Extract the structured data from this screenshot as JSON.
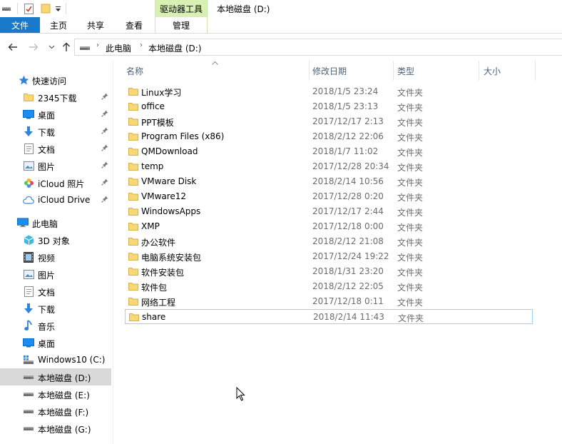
{
  "colors": {
    "accent_blue": "#1979ca",
    "context_tab_green": "#d8f0b3",
    "folder_yellow": "#f8d775",
    "selection_border": "#99d1ff",
    "nav_selected": "#d9d9d9",
    "header_text": "#4c607a",
    "secondary_text": "#6d6d6d"
  },
  "titlebar": {
    "context_tab_label": "驱动器工具",
    "window_title": "本地磁盘 (D:)",
    "quick_access_icons": [
      "drive-icon",
      "properties-icon",
      "new-folder-icon",
      "customize-toolbar-icon"
    ]
  },
  "ribbon": {
    "tabs": {
      "file": "文件",
      "home": "主页",
      "share": "共享",
      "view": "查看",
      "manage": "管理"
    }
  },
  "address": {
    "segments": [
      "此电脑",
      "本地磁盘 (D:)"
    ]
  },
  "nav": {
    "quick_access": "快速访问",
    "quick_items": [
      {
        "label": "2345下载",
        "icon": "folder-icon",
        "pinned": true
      },
      {
        "label": "桌面",
        "icon": "desktop-icon",
        "pinned": true
      },
      {
        "label": "下载",
        "icon": "download-icon",
        "pinned": true
      },
      {
        "label": "文档",
        "icon": "documents-icon",
        "pinned": true
      },
      {
        "label": "图片",
        "icon": "pictures-icon",
        "pinned": true
      },
      {
        "label": "iCloud 照片",
        "icon": "icloud-photos-icon",
        "pinned": true
      },
      {
        "label": "iCloud Drive",
        "icon": "icloud-drive-icon",
        "pinned": true
      }
    ],
    "this_pc": "此电脑",
    "pc_items": [
      {
        "label": "3D 对象",
        "icon": "3d-objects-icon"
      },
      {
        "label": "视频",
        "icon": "videos-icon"
      },
      {
        "label": "图片",
        "icon": "pictures-icon"
      },
      {
        "label": "文档",
        "icon": "documents-icon"
      },
      {
        "label": "下载",
        "icon": "download-icon"
      },
      {
        "label": "音乐",
        "icon": "music-icon"
      },
      {
        "label": "桌面",
        "icon": "desktop-icon"
      },
      {
        "label": "Windows10 (C:)",
        "icon": "windows-drive-icon"
      },
      {
        "label": "本地磁盘 (D:)",
        "icon": "drive-icon",
        "selected": true
      },
      {
        "label": "本地磁盘 (E:)",
        "icon": "drive-icon"
      },
      {
        "label": "本地磁盘 (F:)",
        "icon": "drive-icon"
      },
      {
        "label": "本地磁盘 (G:)",
        "icon": "drive-icon"
      }
    ]
  },
  "list": {
    "headers": {
      "name": "名称",
      "modified": "修改日期",
      "type": "类型",
      "size": "大小"
    },
    "rows": [
      {
        "name": "Linux学习",
        "modified": "2018/1/5 23:24",
        "type": "文件夹"
      },
      {
        "name": "office",
        "modified": "2018/1/5 23:13",
        "type": "文件夹"
      },
      {
        "name": "PPT模板",
        "modified": "2017/12/17 2:13",
        "type": "文件夹"
      },
      {
        "name": "Program Files (x86)",
        "modified": "2018/2/12 22:06",
        "type": "文件夹"
      },
      {
        "name": "QMDownload",
        "modified": "2018/1/7 11:02",
        "type": "文件夹"
      },
      {
        "name": "temp",
        "modified": "2017/12/28 20:34",
        "type": "文件夹"
      },
      {
        "name": "VMware Disk",
        "modified": "2018/2/14 10:56",
        "type": "文件夹"
      },
      {
        "name": "VMware12",
        "modified": "2017/12/28 0:20",
        "type": "文件夹"
      },
      {
        "name": "WindowsApps",
        "modified": "2017/12/17 2:44",
        "type": "文件夹"
      },
      {
        "name": "XMP",
        "modified": "2017/12/18 0:00",
        "type": "文件夹"
      },
      {
        "name": "办公软件",
        "modified": "2018/2/12 21:08",
        "type": "文件夹"
      },
      {
        "name": "电脑系统安装包",
        "modified": "2017/12/24 19:22",
        "type": "文件夹"
      },
      {
        "name": "软件安装包",
        "modified": "2018/1/31 23:20",
        "type": "文件夹"
      },
      {
        "name": "软件包",
        "modified": "2018/2/12 22:05",
        "type": "文件夹"
      },
      {
        "name": "网络工程",
        "modified": "2017/12/18 0:11",
        "type": "文件夹"
      },
      {
        "name": "share",
        "modified": "2018/2/14 11:43",
        "type": "文件夹",
        "selected": true
      }
    ]
  }
}
